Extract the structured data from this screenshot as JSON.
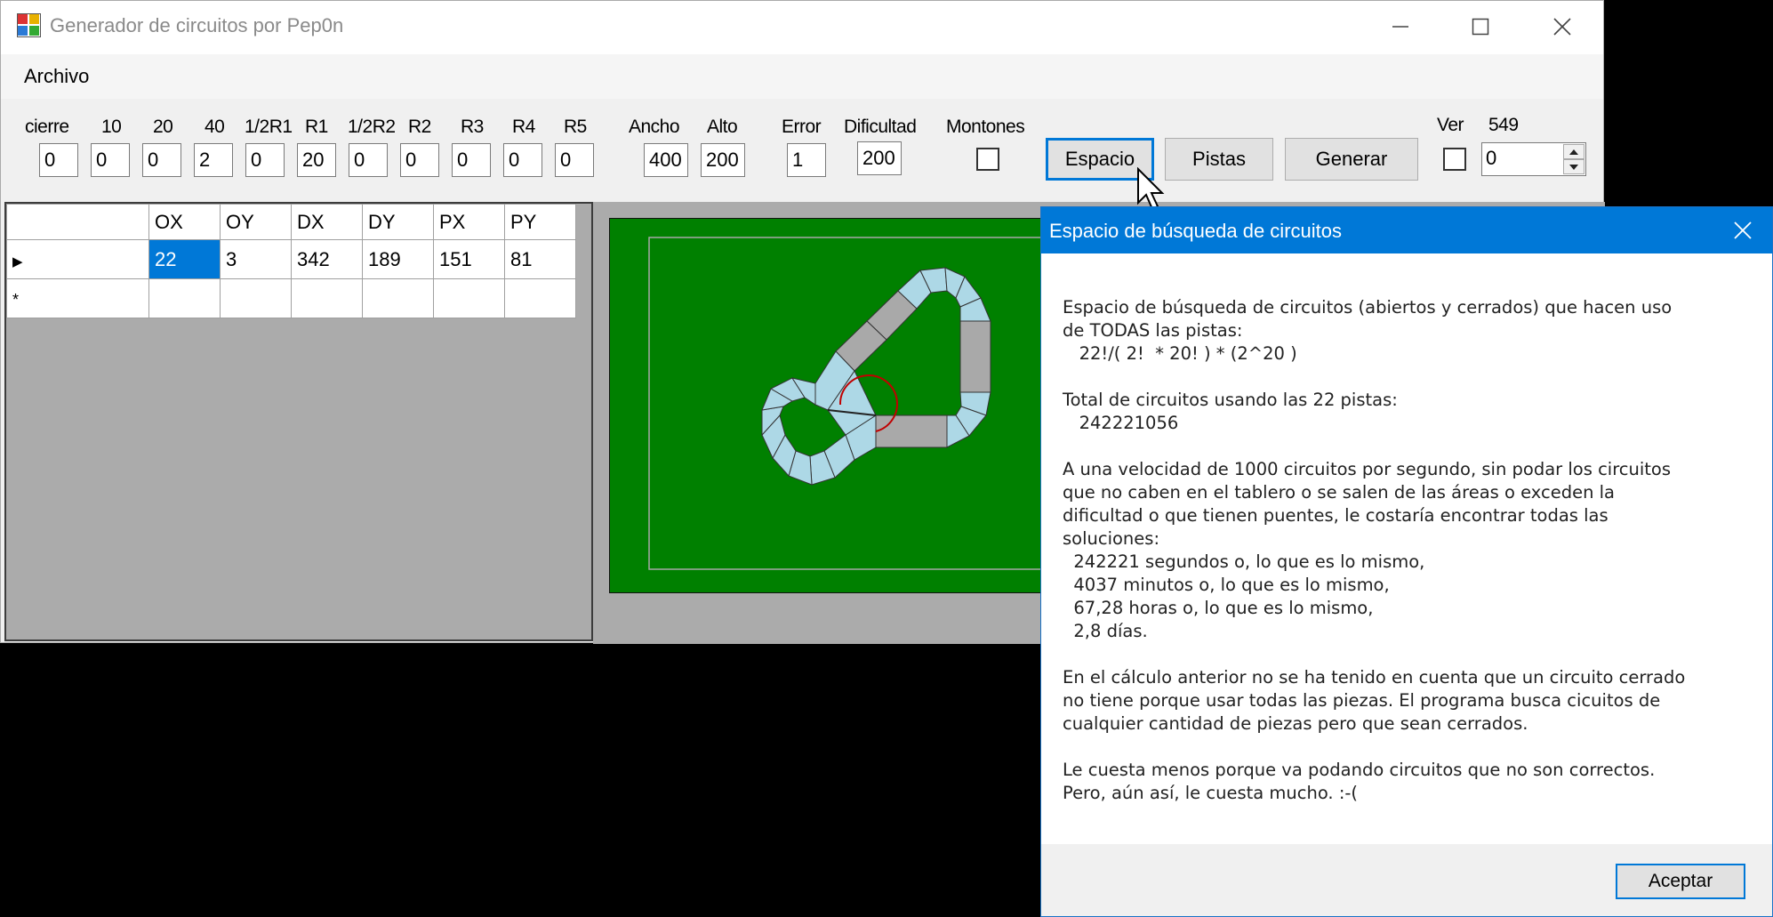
{
  "window": {
    "title": "Generador de circuitos por Pep0n"
  },
  "menu": {
    "archivo": "Archivo"
  },
  "params": [
    {
      "label": "cierre",
      "value": "0"
    },
    {
      "label": "10",
      "value": "0"
    },
    {
      "label": "20",
      "value": "0"
    },
    {
      "label": "40",
      "value": "2"
    },
    {
      "label": "1/2R1",
      "value": "0"
    },
    {
      "label": "R1",
      "value": "20"
    },
    {
      "label": "1/2R2",
      "value": "0"
    },
    {
      "label": "R2",
      "value": "0"
    },
    {
      "label": "R3",
      "value": "0"
    },
    {
      "label": "R4",
      "value": "0"
    },
    {
      "label": "R5",
      "value": "0"
    },
    {
      "label": "Ancho",
      "value": "400"
    },
    {
      "label": "Alto",
      "value": "200"
    },
    {
      "label": "Error",
      "value": "1"
    },
    {
      "label": "Dificultad",
      "value": "200"
    }
  ],
  "montones": {
    "label": "Montones",
    "checked": false
  },
  "buttons": {
    "espacio": "Espacio",
    "pistas": "Pistas",
    "generar": "Generar"
  },
  "ver": {
    "label": "Ver",
    "count": "549",
    "checked": false,
    "value": "0"
  },
  "grid": {
    "columns": [
      "OX",
      "OY",
      "DX",
      "DY",
      "PX",
      "PY"
    ],
    "rows": [
      [
        "22",
        "3",
        "342",
        "189",
        "151",
        "81"
      ]
    ],
    "row_marker_current": "▶",
    "row_marker_new": "*"
  },
  "colors": {
    "accent": "#0078d7",
    "board": "#008000",
    "track_curve": "#add8e6",
    "track_straight": "#a9a9a9"
  },
  "dialog": {
    "title": "Espacio de búsqueda de circuitos",
    "body": "Espacio de búsqueda de circuitos (abiertos y cerrados) que hacen uso\nde TODAS las pistas:\n   22!/( 2!  * 20! ) * (2^20 )\n\nTotal de circuitos usando las 22 pistas:\n   242221056\n\nA una velocidad de 1000 circuitos por segundo, sin podar los circuitos\nque no caben en el tablero o se salen de las áreas o exceden la\ndificultad o que tienen puentes, le costaría encontrar todas las\nsoluciones:\n  242221 segundos o, lo que es lo mismo,\n  4037 minutos o, lo que es lo mismo,\n  67,28 horas o, lo que es lo mismo,\n  2,8 días.\n\nEn el cálculo anterior no se ha tenido en cuenta que un circuito cerrado\nno tiene porque usar todas las piezas. El programa busca cicuitos de\ncualquier cantidad de piezas pero que sean cerrados.\n\nLe cuesta menos porque va podando circuitos que no son correctos.\nPero, aún así, le cuesta mucho. :-(",
    "ok_button": "Aceptar"
  }
}
